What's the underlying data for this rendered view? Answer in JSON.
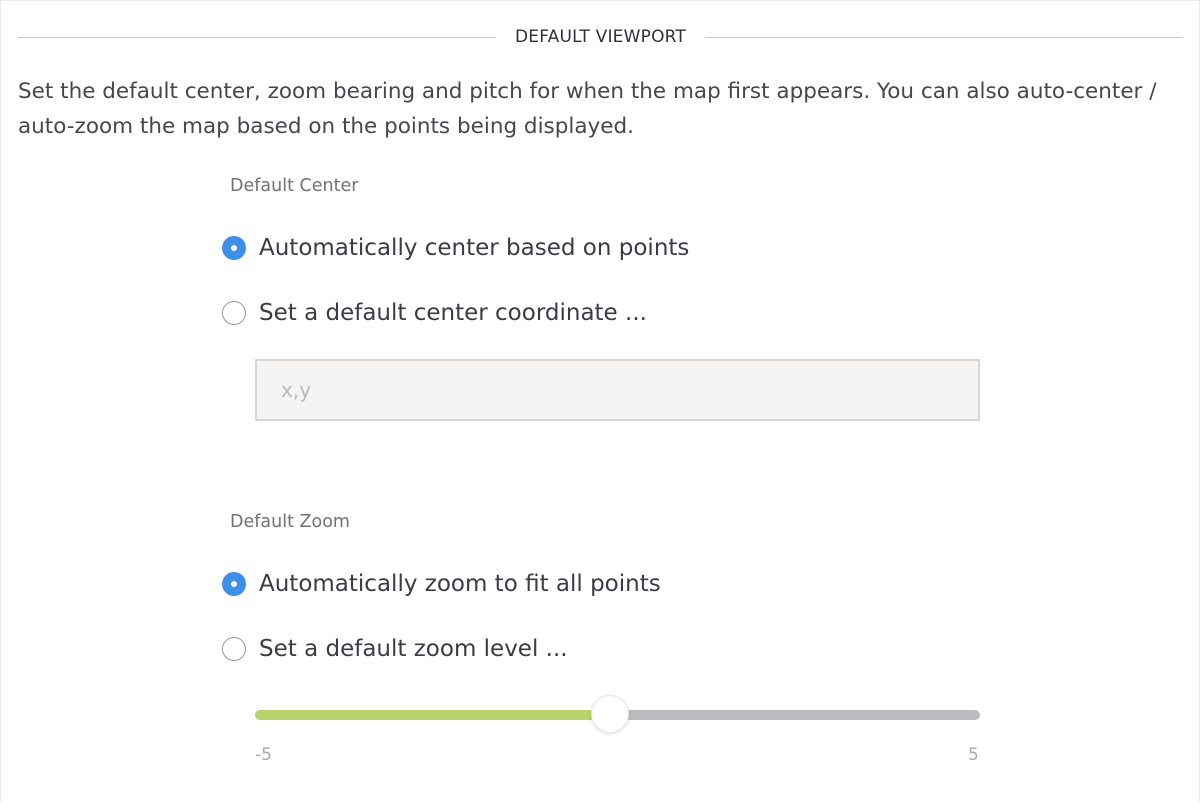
{
  "section": {
    "title": "DEFAULT VIEWPORT",
    "description": "Set the default center, zoom bearing and pitch for when the map first appears. You can also auto-center / auto-zoom the map based on the points being displayed."
  },
  "center": {
    "label": "Default Center",
    "options": [
      {
        "label": "Automatically center based on points",
        "checked": true
      },
      {
        "label": "Set a default center coordinate ...",
        "checked": false
      }
    ],
    "input": {
      "value": "",
      "placeholder": "x,y"
    }
  },
  "zoom": {
    "label": "Default Zoom",
    "options": [
      {
        "label": "Automatically zoom to fit all points",
        "checked": true
      },
      {
        "label": "Set a default zoom level ...",
        "checked": false
      }
    ],
    "slider": {
      "min": -5,
      "max": 5,
      "value": -0.1,
      "min_label": "-5",
      "max_label": "5"
    }
  },
  "colors": {
    "accent": "#3d8fea",
    "slider_fill": "#b6d36c",
    "slider_track": "#bbbbbd"
  }
}
